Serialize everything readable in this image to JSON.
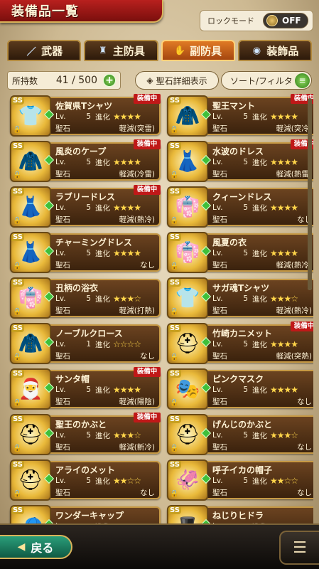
{
  "header": {
    "title": "装備品一覧",
    "lock_mode_label": "ロックモード",
    "lock_mode_state": "OFF"
  },
  "tabs": [
    {
      "label": "武器",
      "icon": "sword-icon",
      "active": false
    },
    {
      "label": "主防具",
      "icon": "armor-icon",
      "active": false
    },
    {
      "label": "副防具",
      "icon": "gauntlet-icon",
      "active": true
    },
    {
      "label": "装飾品",
      "icon": "accessory-icon",
      "active": false
    }
  ],
  "toolbar": {
    "count_label": "所持数",
    "count_value": "41 / 500",
    "detail_label": "聖石詳細表示",
    "sort_label": "ソート/フィルタ"
  },
  "items": [
    {
      "name": "佐賀県Tシャツ",
      "lv": "5",
      "stars": "★★★★",
      "stone": "軽減(突雷)",
      "equipped": true,
      "art": "👕"
    },
    {
      "name": "聖王マント",
      "lv": "5",
      "stars": "★★★★",
      "stone": "軽減(突冷)",
      "equipped": true,
      "art": "🧥"
    },
    {
      "name": "風炎のケープ",
      "lv": "5",
      "stars": "★★★★",
      "stone": "軽減(冷雷)",
      "equipped": true,
      "art": "🧥"
    },
    {
      "name": "水波のドレス",
      "lv": "5",
      "stars": "★★★★",
      "stone": "軽減(熱雷)",
      "equipped": true,
      "art": "👗"
    },
    {
      "name": "ラブリードレス",
      "lv": "5",
      "stars": "★★★★",
      "stone": "軽減(熱冷)",
      "equipped": true,
      "art": "👗"
    },
    {
      "name": "クィーンドレス",
      "lv": "5",
      "stars": "★★★★",
      "stone": "なし",
      "equipped": false,
      "art": "👘"
    },
    {
      "name": "チャーミングドレス",
      "lv": "5",
      "stars": "★★★★",
      "stone": "なし",
      "equipped": false,
      "art": "👗"
    },
    {
      "name": "風夏の衣",
      "lv": "5",
      "stars": "★★★★",
      "stone": "軽減(熱冷)",
      "equipped": false,
      "art": "👘"
    },
    {
      "name": "丑柄の浴衣",
      "lv": "5",
      "stars": "★★★☆",
      "stone": "軽減(打熱)",
      "equipped": false,
      "art": "👘"
    },
    {
      "name": "サガ魂Tシャツ",
      "lv": "5",
      "stars": "★★★☆",
      "stone": "軽減(熱冷)",
      "equipped": false,
      "art": "👕"
    },
    {
      "name": "ノーブルクロース",
      "lv": "1",
      "stars": "☆☆☆☆",
      "stone": "なし",
      "equipped": false,
      "art": "🧥"
    },
    {
      "name": "竹崎カニメット",
      "lv": "5",
      "stars": "★★★★",
      "stone": "軽減(突熱)",
      "equipped": true,
      "art": "⛑"
    },
    {
      "name": "サンタ帽",
      "lv": "5",
      "stars": "★★★★",
      "stone": "軽減(陽陰)",
      "equipped": true,
      "art": "🎅"
    },
    {
      "name": "ピンクマスク",
      "lv": "5",
      "stars": "★★★★",
      "stone": "なし",
      "equipped": false,
      "art": "🎭"
    },
    {
      "name": "聖王のかぶと",
      "lv": "5",
      "stars": "★★★☆",
      "stone": "軽減(斬冷)",
      "equipped": true,
      "art": "⛑"
    },
    {
      "name": "げんじのかぶと",
      "lv": "5",
      "stars": "★★★☆",
      "stone": "なし",
      "equipped": false,
      "art": "⛑"
    },
    {
      "name": "アライのメット",
      "lv": "5",
      "stars": "★★☆☆",
      "stone": "なし",
      "equipped": false,
      "art": "⛑"
    },
    {
      "name": "呼子イカの帽子",
      "lv": "5",
      "stars": "★★☆☆",
      "stone": "なし",
      "equipped": false,
      "art": "🦑"
    },
    {
      "name": "ワンダーキャップ",
      "lv": "",
      "stars": "",
      "stone": "",
      "equipped": false,
      "art": "🧢"
    },
    {
      "name": "ねじりヒドラ",
      "lv": "",
      "stars": "",
      "stone": "",
      "equipped": false,
      "art": "🎩"
    }
  ],
  "labels": {
    "lv": "Lv.",
    "evo": "進化",
    "stone": "聖石",
    "equipped": "装備中",
    "ss": "SS"
  },
  "footer": {
    "back_label": "戻る"
  },
  "colors": {
    "equipped_badge": "#c01818",
    "tab_active": "#e07a24",
    "frame_gold": "#c79a45"
  }
}
